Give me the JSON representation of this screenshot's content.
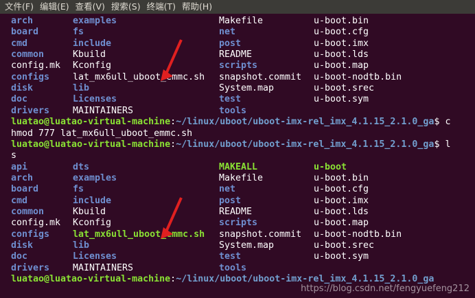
{
  "menu": [
    "文件(F)",
    "编辑(E)",
    "查看(V)",
    "搜索(S)",
    "终端(T)",
    "帮助(H)"
  ],
  "listing1": [
    [
      [
        "arch",
        "dir"
      ],
      [
        "examples",
        "dir"
      ],
      [
        "Makefile",
        "file"
      ],
      [
        "u-boot.bin",
        "file"
      ]
    ],
    [
      [
        "board",
        "dir"
      ],
      [
        "fs",
        "dir"
      ],
      [
        "net",
        "dir"
      ],
      [
        "u-boot.cfg",
        "file"
      ]
    ],
    [
      [
        "cmd",
        "dir"
      ],
      [
        "include",
        "dir"
      ],
      [
        "post",
        "dir"
      ],
      [
        "u-boot.imx",
        "file"
      ]
    ],
    [
      [
        "common",
        "dir"
      ],
      [
        "Kbuild",
        "file"
      ],
      [
        "README",
        "file"
      ],
      [
        "u-boot.lds",
        "file"
      ]
    ],
    [
      [
        "config.mk",
        "file"
      ],
      [
        "Kconfig",
        "file"
      ],
      [
        "scripts",
        "dir"
      ],
      [
        "u-boot.map",
        "file"
      ]
    ],
    [
      [
        "configs",
        "dir"
      ],
      [
        "lat_mx6ull_uboot_emmc.sh",
        "file"
      ],
      [
        "snapshot.commit",
        "file"
      ],
      [
        "u-boot-nodtb.bin",
        "file"
      ]
    ],
    [
      [
        "disk",
        "dir"
      ],
      [
        "lib",
        "dir"
      ],
      [
        "System.map",
        "file"
      ],
      [
        "u-boot.srec",
        "file"
      ]
    ],
    [
      [
        "doc",
        "dir"
      ],
      [
        "Licenses",
        "dir"
      ],
      [
        "test",
        "dir"
      ],
      [
        "u-boot.sym",
        "file"
      ]
    ],
    [
      [
        "drivers",
        "dir"
      ],
      [
        "MAINTAINERS",
        "file"
      ],
      [
        "tools",
        "dir"
      ],
      [
        "",
        ""
      ]
    ]
  ],
  "prompt1": {
    "user": "luatao@luatao-virtual-machine",
    "path": "~/linux/uboot/uboot-imx-rel_imx_4.1.15_2.1.0_ga",
    "cmd_line1": "$ c",
    "cmd_line2": "hmod 777 lat_mx6ull_uboot_emmc.sh"
  },
  "prompt2": {
    "user": "luatao@luatao-virtual-machine",
    "path": "~/linux/uboot/uboot-imx-rel_imx_4.1.15_2.1.0_ga",
    "cmd_line1": "$ l",
    "cmd_line2": "s"
  },
  "listing2": [
    [
      [
        "api",
        "dir"
      ],
      [
        "dts",
        "dir"
      ],
      [
        "MAKEALL",
        "exec"
      ],
      [
        "u-boot",
        "exec"
      ]
    ],
    [
      [
        "arch",
        "dir"
      ],
      [
        "examples",
        "dir"
      ],
      [
        "Makefile",
        "file"
      ],
      [
        "u-boot.bin",
        "file"
      ]
    ],
    [
      [
        "board",
        "dir"
      ],
      [
        "fs",
        "dir"
      ],
      [
        "net",
        "dir"
      ],
      [
        "u-boot.cfg",
        "file"
      ]
    ],
    [
      [
        "cmd",
        "dir"
      ],
      [
        "include",
        "dir"
      ],
      [
        "post",
        "dir"
      ],
      [
        "u-boot.imx",
        "file"
      ]
    ],
    [
      [
        "common",
        "dir"
      ],
      [
        "Kbuild",
        "file"
      ],
      [
        "README",
        "file"
      ],
      [
        "u-boot.lds",
        "file"
      ]
    ],
    [
      [
        "config.mk",
        "file"
      ],
      [
        "Kconfig",
        "file"
      ],
      [
        "scripts",
        "dir"
      ],
      [
        "u-boot.map",
        "file"
      ]
    ],
    [
      [
        "configs",
        "dir"
      ],
      [
        "lat_mx6ull_uboot_emmc.sh",
        "exec"
      ],
      [
        "snapshot.commit",
        "file"
      ],
      [
        "u-boot-nodtb.bin",
        "file"
      ]
    ],
    [
      [
        "disk",
        "dir"
      ],
      [
        "lib",
        "dir"
      ],
      [
        "System.map",
        "file"
      ],
      [
        "u-boot.srec",
        "file"
      ]
    ],
    [
      [
        "doc",
        "dir"
      ],
      [
        "Licenses",
        "dir"
      ],
      [
        "test",
        "dir"
      ],
      [
        "u-boot.sym",
        "file"
      ]
    ],
    [
      [
        "drivers",
        "dir"
      ],
      [
        "MAINTAINERS",
        "file"
      ],
      [
        "tools",
        "dir"
      ],
      [
        "",
        ""
      ]
    ]
  ],
  "prompt3": {
    "user": "luatao@luatao-virtual-machine",
    "path": "~/linux/uboot/uboot-imx-rel_imx_4.1.15_2.1.0_ga"
  },
  "watermark": "https://blog.csdn.net/fengyuefeng212",
  "colors": {
    "background": "#300a24",
    "directory": "#6f8fd0",
    "executable": "#8ae234",
    "prompt_user": "#8ae234",
    "prompt_path": "#729fcf",
    "arrow": "#e02020"
  }
}
